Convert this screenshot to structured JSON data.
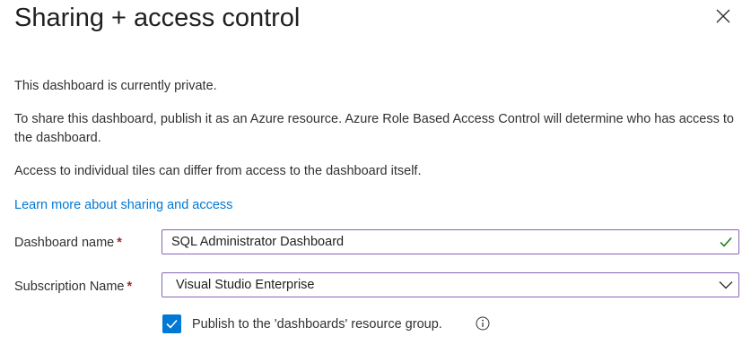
{
  "panel": {
    "title": "Sharing + access control",
    "close_icon": "close-icon"
  },
  "content": {
    "status_text": "This dashboard is currently private.",
    "publish_description": "To share this dashboard, publish it as an Azure resource. Azure Role Based Access Control will determine who has access to the dashboard.",
    "tiles_note": "Access to individual tiles can differ from access to the dashboard itself.",
    "learn_more_link": "Learn more about sharing and access"
  },
  "form": {
    "dashboard_name": {
      "label": "Dashboard name",
      "required_marker": "*",
      "value": "SQL Administrator Dashboard",
      "icon": "checkmark-icon"
    },
    "subscription": {
      "label": "Subscription Name",
      "required_marker": "*",
      "value": "Visual Studio Enterprise",
      "icon": "chevron-down-icon"
    },
    "publish_checkbox": {
      "checked": true,
      "label": "Publish to the 'dashboards' resource group.",
      "icon": "info-icon"
    }
  },
  "colors": {
    "accent": "#0078d4",
    "field_border": "#8764b8",
    "valid": "#107c10",
    "required": "#a4262c"
  }
}
